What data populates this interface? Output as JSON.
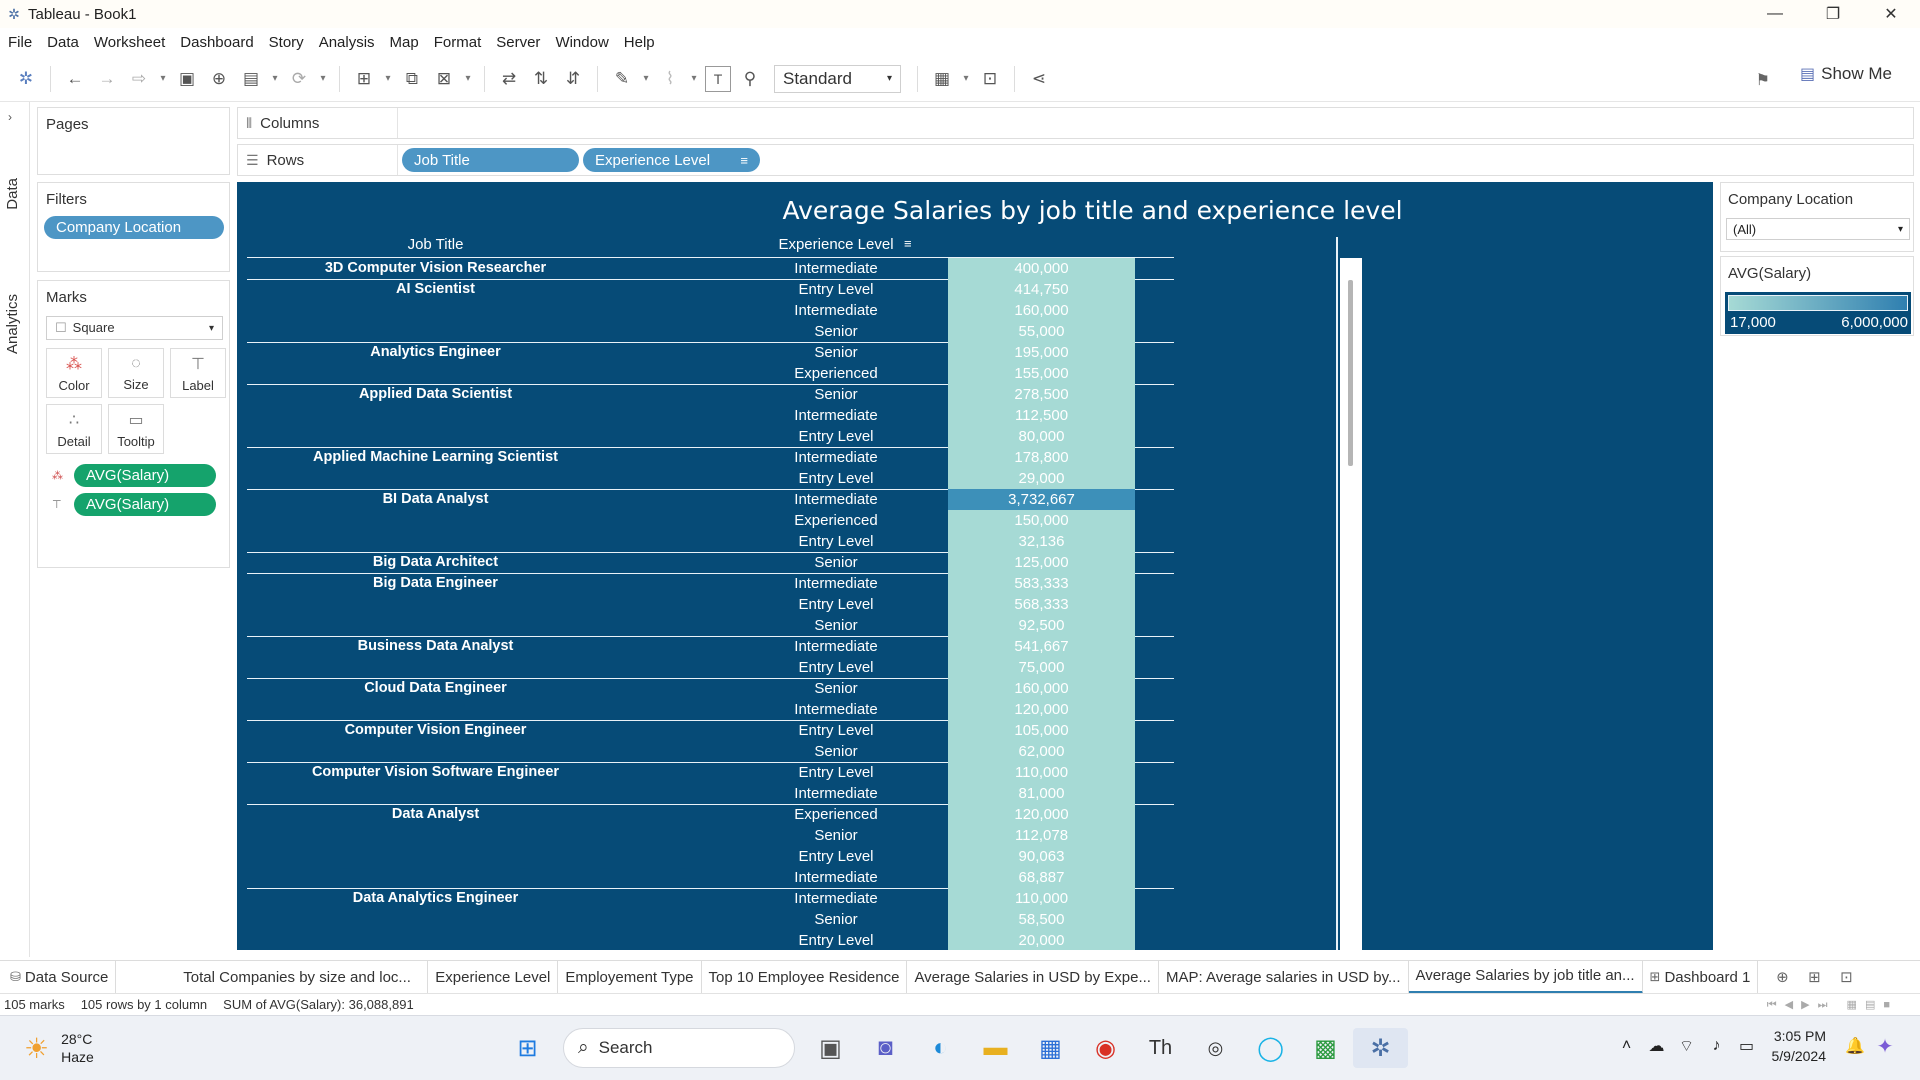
{
  "window": {
    "title": "Tableau - Book1"
  },
  "menu": [
    "File",
    "Data",
    "Worksheet",
    "Dashboard",
    "Story",
    "Analysis",
    "Map",
    "Format",
    "Server",
    "Window",
    "Help"
  ],
  "toolbar": {
    "fit_mode": "Standard",
    "show_me": "Show Me"
  },
  "left_rail": {
    "data_tab": "Data",
    "analytics_tab": "Analytics"
  },
  "pages": {
    "title": "Pages"
  },
  "filters": {
    "title": "Filters",
    "pills": [
      "Company Location"
    ]
  },
  "marks": {
    "title": "Marks",
    "type": "Square",
    "buttons": [
      "Color",
      "Size",
      "Label",
      "Detail",
      "Tooltip"
    ],
    "pills": [
      "AVG(Salary)",
      "AVG(Salary)"
    ]
  },
  "shelves": {
    "columns_label": "Columns",
    "rows_label": "Rows",
    "rows_pills": [
      "Job Title",
      "Experience Level"
    ]
  },
  "viz": {
    "title": "Average Salaries by job title and experience level",
    "headers": {
      "job_title": "Job Title",
      "experience_level": "Experience Level"
    },
    "rows": [
      {
        "job": "3D Computer Vision Researcher",
        "level": "Intermediate",
        "value": "400,000",
        "group_start": true
      },
      {
        "job": "AI Scientist",
        "level": "Entry Level",
        "value": "414,750",
        "group_start": true
      },
      {
        "job": "",
        "level": "Intermediate",
        "value": "160,000"
      },
      {
        "job": "",
        "level": "Senior",
        "value": "55,000"
      },
      {
        "job": "Analytics Engineer",
        "level": "Senior",
        "value": "195,000",
        "group_start": true
      },
      {
        "job": "",
        "level": "Experienced",
        "value": "155,000"
      },
      {
        "job": "Applied Data Scientist",
        "level": "Senior",
        "value": "278,500",
        "group_start": true
      },
      {
        "job": "",
        "level": "Intermediate",
        "value": "112,500"
      },
      {
        "job": "",
        "level": "Entry Level",
        "value": "80,000"
      },
      {
        "job": "Applied Machine Learning Scientist",
        "level": "Intermediate",
        "value": "178,800",
        "group_start": true
      },
      {
        "job": "",
        "level": "Entry Level",
        "value": "29,000"
      },
      {
        "job": "BI Data Analyst",
        "level": "Intermediate",
        "value": "3,732,667",
        "group_start": true,
        "highlight": true
      },
      {
        "job": "",
        "level": "Experienced",
        "value": "150,000"
      },
      {
        "job": "",
        "level": "Entry Level",
        "value": "32,136"
      },
      {
        "job": "Big Data Architect",
        "level": "Senior",
        "value": "125,000",
        "group_start": true
      },
      {
        "job": "Big Data Engineer",
        "level": "Intermediate",
        "value": "583,333",
        "group_start": true
      },
      {
        "job": "",
        "level": "Entry Level",
        "value": "568,333"
      },
      {
        "job": "",
        "level": "Senior",
        "value": "92,500"
      },
      {
        "job": "Business Data Analyst",
        "level": "Intermediate",
        "value": "541,667",
        "group_start": true
      },
      {
        "job": "",
        "level": "Entry Level",
        "value": "75,000"
      },
      {
        "job": "Cloud Data Engineer",
        "level": "Senior",
        "value": "160,000",
        "group_start": true
      },
      {
        "job": "",
        "level": "Intermediate",
        "value": "120,000"
      },
      {
        "job": "Computer Vision Engineer",
        "level": "Entry Level",
        "value": "105,000",
        "group_start": true
      },
      {
        "job": "",
        "level": "Senior",
        "value": "62,000"
      },
      {
        "job": "Computer Vision Software Engineer",
        "level": "Entry Level",
        "value": "110,000",
        "group_start": true
      },
      {
        "job": "",
        "level": "Intermediate",
        "value": "81,000"
      },
      {
        "job": "Data Analyst",
        "level": "Experienced",
        "value": "120,000",
        "group_start": true
      },
      {
        "job": "",
        "level": "Senior",
        "value": "112,078"
      },
      {
        "job": "",
        "level": "Entry Level",
        "value": "90,063"
      },
      {
        "job": "",
        "level": "Intermediate",
        "value": "68,887"
      },
      {
        "job": "Data Analytics Engineer",
        "level": "Intermediate",
        "value": "110,000",
        "group_start": true
      },
      {
        "job": "",
        "level": "Senior",
        "value": "58,500"
      },
      {
        "job": "",
        "level": "Entry Level",
        "value": "20,000"
      }
    ]
  },
  "company_location": {
    "title": "Company Location",
    "selected": "(All)"
  },
  "legend": {
    "title": "AVG(Salary)",
    "min": "17,000",
    "max": "6,000,000",
    "color_low": "#a6dad5",
    "color_high": "#2f7fb0"
  },
  "sheet_tabs": [
    {
      "label": "Data Source",
      "icon": "database-icon"
    },
    {
      "label": "Total Companies by size and loc..."
    },
    {
      "label": "Experience Level"
    },
    {
      "label": "Employement Type"
    },
    {
      "label": "Top 10 Employee Residence"
    },
    {
      "label": "Average Salaries in USD by Expe..."
    },
    {
      "label": "MAP: Average salaries in USD by..."
    },
    {
      "label": "Average Salaries by job title an...",
      "active": true
    },
    {
      "label": "Dashboard 1",
      "icon": "dashboard-icon"
    }
  ],
  "status": {
    "marks": "105 marks",
    "dims": "105 rows by 1 column",
    "sum": "SUM of AVG(Salary): 36,088,891"
  },
  "taskbar": {
    "weather_temp": "28°C",
    "weather_desc": "Haze",
    "search": "Search",
    "time": "3:05 PM",
    "date": "5/9/2024"
  },
  "colors": {
    "viz_bg": "#064b77",
    "cell": "#a6dad5",
    "cell_highlight": "#3d90b9",
    "pill_blue": "#4d96c5",
    "pill_green": "#15a36c"
  }
}
